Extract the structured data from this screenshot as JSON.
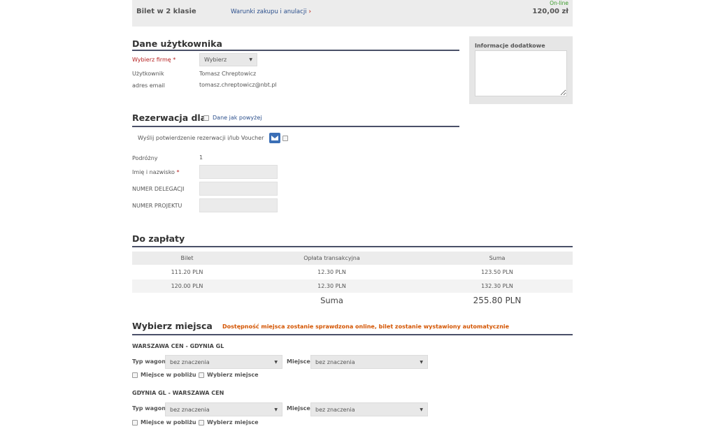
{
  "ticket_bar": {
    "title": "Bilet w 2 klasie",
    "terms_link": "Warunki zakupu i anulacji",
    "terms_chevron": "›",
    "status": "On-line",
    "price": "120,00 zł"
  },
  "user_section": {
    "title": "Dane użytkownika",
    "company_label": "Wybierz firmę",
    "required_mark": "*",
    "company_select": "Wybierz",
    "user_label": "Użytkownik",
    "user_value": "Tomasz Chreptowicz",
    "email_label": "adres email",
    "email_value": "tomasz.chreptowicz@nbt.pl"
  },
  "additional_info": {
    "title": "Informacje dodatkowe"
  },
  "reservation_section": {
    "title": "Rezerwacja dla",
    "same_as_above": "Dane jak powyżej",
    "send_confirmation": "Wyślij potwierdzenie rezerwacji i/lub Voucher",
    "traveler_label": "Podróżny",
    "traveler_value": "1",
    "name_label": "Imię i nazwisko",
    "required_mark": "*",
    "delegation_label": "NUMER DELEGACJI",
    "project_label": "NUMER PROJEKTU"
  },
  "payment_section": {
    "title": "Do zapłaty",
    "columns": [
      "Bilet",
      "Opłata transakcyjna",
      "Suma"
    ],
    "rows": [
      [
        "111.20 PLN",
        "12.30 PLN",
        "123.50 PLN"
      ],
      [
        "120.00 PLN",
        "12.30 PLN",
        "132.30 PLN"
      ]
    ],
    "total_label": "Suma",
    "total_value": "255.80 PLN"
  },
  "seat_section": {
    "title": "Wybierz miejsca",
    "notice": "Dostępność miejsca zostanie sprawdzona online, bilet zostanie wystawiony automatycznie",
    "routes": [
      {
        "name": "WARSZAWA CEN - GDYNIA GL",
        "car_type_label": "Typ wagonu",
        "car_type_value": "bez znaczenia",
        "seat_label": "Miejsce:",
        "seat_value": "bez znaczenia",
        "nearby_label": "Miejsce w pobliżu",
        "choose_seat_label": "Wybierz miejsce"
      },
      {
        "name": "GDYNIA GL - WARSZAWA CEN",
        "car_type_label": "Typ wagonu",
        "car_type_value": "bez znaczenia",
        "seat_label": "Miejsce:",
        "seat_value": "bez znaczenia",
        "nearby_label": "Miejsce w pobliżu",
        "choose_seat_label": "Wybierz miejsce"
      }
    ]
  },
  "icons": {
    "select_arrow": "▼",
    "mail": "envelope-icon"
  }
}
